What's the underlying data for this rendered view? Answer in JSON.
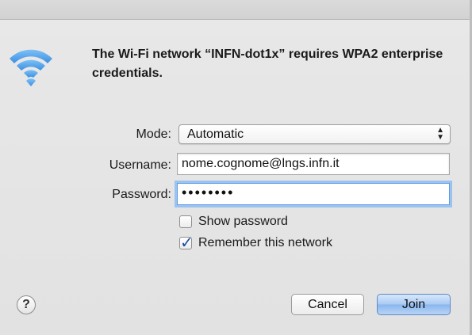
{
  "dialog": {
    "title": "The Wi-Fi network “INFN-dot1x” requires WPA2 enterprise credentials."
  },
  "form": {
    "mode_label": "Mode:",
    "mode_value": "Automatic",
    "username_label": "Username:",
    "username_value": "nome.cognome@lngs.infn.it",
    "password_label": "Password:",
    "password_value": "••••••••",
    "show_password_label": "Show password",
    "show_password_checked": false,
    "remember_label": "Remember this network",
    "remember_checked": true
  },
  "buttons": {
    "help_label": "?",
    "cancel_label": "Cancel",
    "join_label": "Join"
  },
  "icons": {
    "wifi": "wifi-icon",
    "select_arrows": "updown-arrows-icon",
    "checkmark": "checkmark-icon"
  },
  "colors": {
    "wifi_blue": "#5aa9ee",
    "focus_ring": "#9cc3f0",
    "default_button": "#8ab6ee"
  }
}
